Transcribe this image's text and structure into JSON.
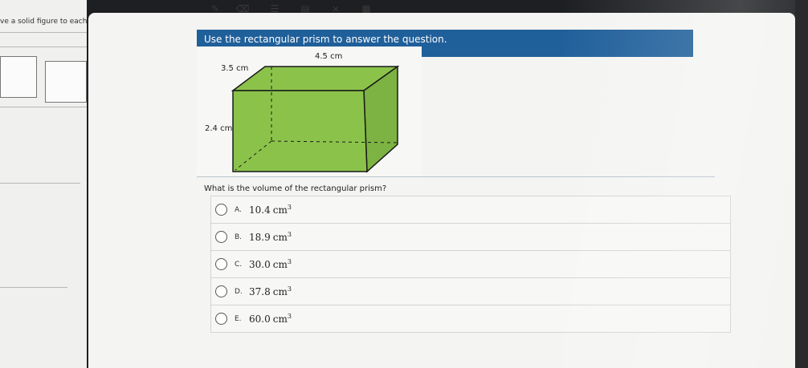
{
  "left_panel": {
    "prompt": "ve a solid figure to each c"
  },
  "toolbar": {
    "tools": [
      {
        "icon": "pencil-icon",
        "glyph": "✎"
      },
      {
        "icon": "eraser-icon",
        "glyph": "⌫"
      },
      {
        "icon": "reference-sheet-icon",
        "glyph": "☰"
      },
      {
        "icon": "line-reader-icon",
        "glyph": "▤"
      },
      {
        "icon": "answer-eliminator-icon",
        "glyph": "⨯"
      },
      {
        "icon": "calculator-icon",
        "glyph": "▦"
      }
    ]
  },
  "question": {
    "instruction": "Use the rectangular prism to answer the question.",
    "prompt": "What is the volume of the rectangular prism?"
  },
  "diagram": {
    "length_label": "4.5 cm",
    "width_label": "3.5 cm",
    "height_label": "2.4 cm",
    "fill_color": "#8bc34a",
    "edge_color": "#1a1a1a"
  },
  "answer_choices": [
    {
      "letter": "A.",
      "value": "10.4",
      "unit": "cm",
      "exp": "3"
    },
    {
      "letter": "B.",
      "value": "18.9",
      "unit": "cm",
      "exp": "3"
    },
    {
      "letter": "C.",
      "value": "30.0",
      "unit": "cm",
      "exp": "3"
    },
    {
      "letter": "D.",
      "value": "37.8",
      "unit": "cm",
      "exp": "3"
    },
    {
      "letter": "E.",
      "value": "60.0",
      "unit": "cm",
      "exp": "3"
    }
  ],
  "colors": {
    "banner": "#1f5f9a",
    "panel": "#f4f4f2"
  }
}
